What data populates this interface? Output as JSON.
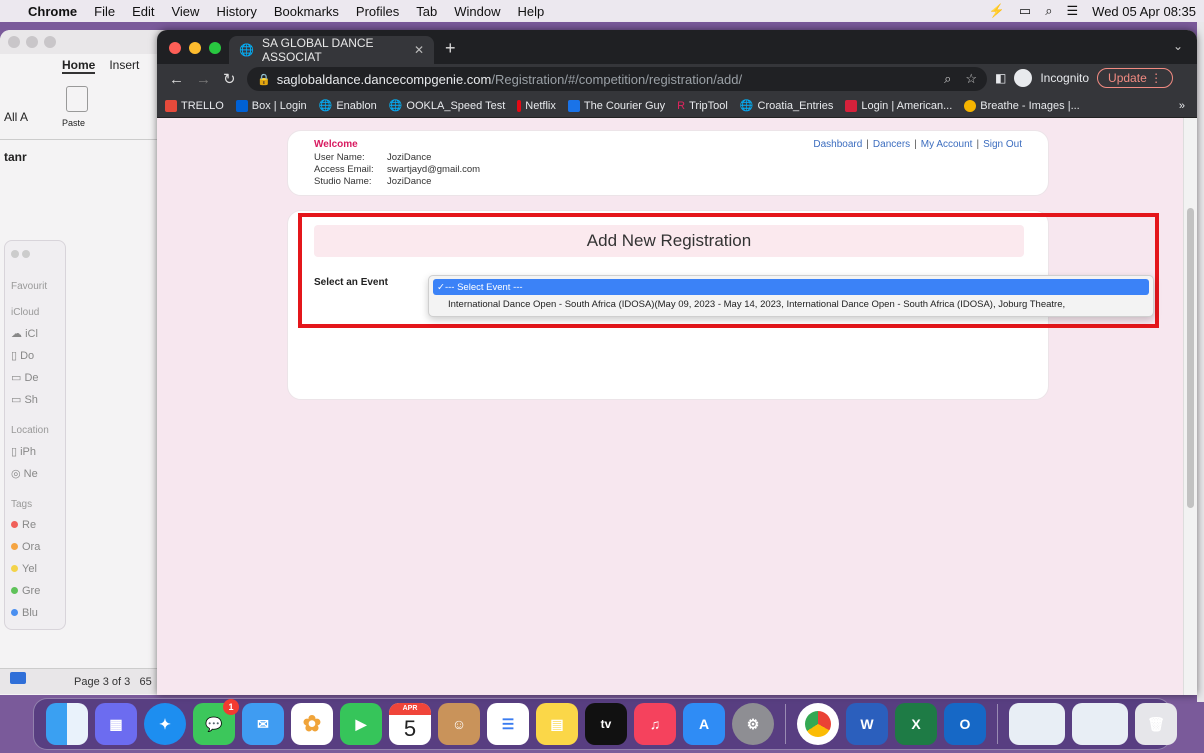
{
  "menubar": {
    "app": "Chrome",
    "items": [
      "File",
      "Edit",
      "View",
      "History",
      "Bookmarks",
      "Profiles",
      "Tab",
      "Window",
      "Help"
    ],
    "clock": "Wed 05 Apr  08:35"
  },
  "word": {
    "tabs": [
      "Home",
      "Insert"
    ],
    "paste_label": "Paste",
    "all_label": "All A",
    "account_label": "tanr",
    "status": "Page 3 of 3",
    "status_extra": "65"
  },
  "finder": {
    "favourites": "Favourit",
    "icloud": "iCloud",
    "icloud_items": [
      "iCl",
      "Do",
      "De",
      "Sh"
    ],
    "locations": "Location",
    "location_items": [
      "iPh",
      "Ne"
    ],
    "tags": "Tags",
    "tag_items": [
      {
        "label": "Re",
        "color": "#f0605a"
      },
      {
        "label": "Ora",
        "color": "#f5a442"
      },
      {
        "label": "Yel",
        "color": "#f3d34a"
      },
      {
        "label": "Gre",
        "color": "#5fc25a"
      },
      {
        "label": "Blu",
        "color": "#4a8ff0"
      }
    ]
  },
  "chrome": {
    "tab_title": "SA GLOBAL DANCE ASSOCIAT",
    "url_host": "saglobaldance.dancecompgenie.com",
    "url_path": "/Registration/#/competition/registration/add/",
    "incognito_label": "Incognito",
    "update_label": "Update",
    "bookmarks": [
      {
        "label": "TRELLO",
        "color": "#e64a3b"
      },
      {
        "label": "Box | Login",
        "color": "#0061d5"
      },
      {
        "label": "Enablon",
        "color": "#9aa0a6"
      },
      {
        "label": "OOKLA_Speed Test",
        "color": "#9aa0a6"
      },
      {
        "label": "Netflix",
        "color": "#e50914"
      },
      {
        "label": "The Courier Guy",
        "color": "#1a73e8"
      },
      {
        "label": "TripTool",
        "color": "#e0245e"
      },
      {
        "label": "Croatia_Entries",
        "color": "#9aa0a6"
      },
      {
        "label": "Login | American...",
        "color": "#d6213b"
      },
      {
        "label": "Breathe - Images |...",
        "color": "#f5b400"
      }
    ]
  },
  "welcome": {
    "title": "Welcome",
    "user_name_key": "User Name:",
    "user_name": "JoziDance",
    "email_key": "Access Email:",
    "email": "swartjayd@gmail.com",
    "studio_key": "Studio Name:",
    "studio": "JoziDance",
    "links": [
      "Dashboard",
      "Dancers",
      "My Account",
      "Sign Out"
    ]
  },
  "registration": {
    "title": "Add New Registration",
    "select_label": "Select an Event",
    "selected_option": "--- Select Event ---",
    "event_option": "International Dance Open - South Africa (IDOSA)(May 09, 2023 - May 14, 2023, International Dance Open - South Africa (IDOSA), Joburg Theatre,"
  },
  "dock": {
    "calendar_month": "APR",
    "calendar_day": "5",
    "messages_badge": "1"
  }
}
